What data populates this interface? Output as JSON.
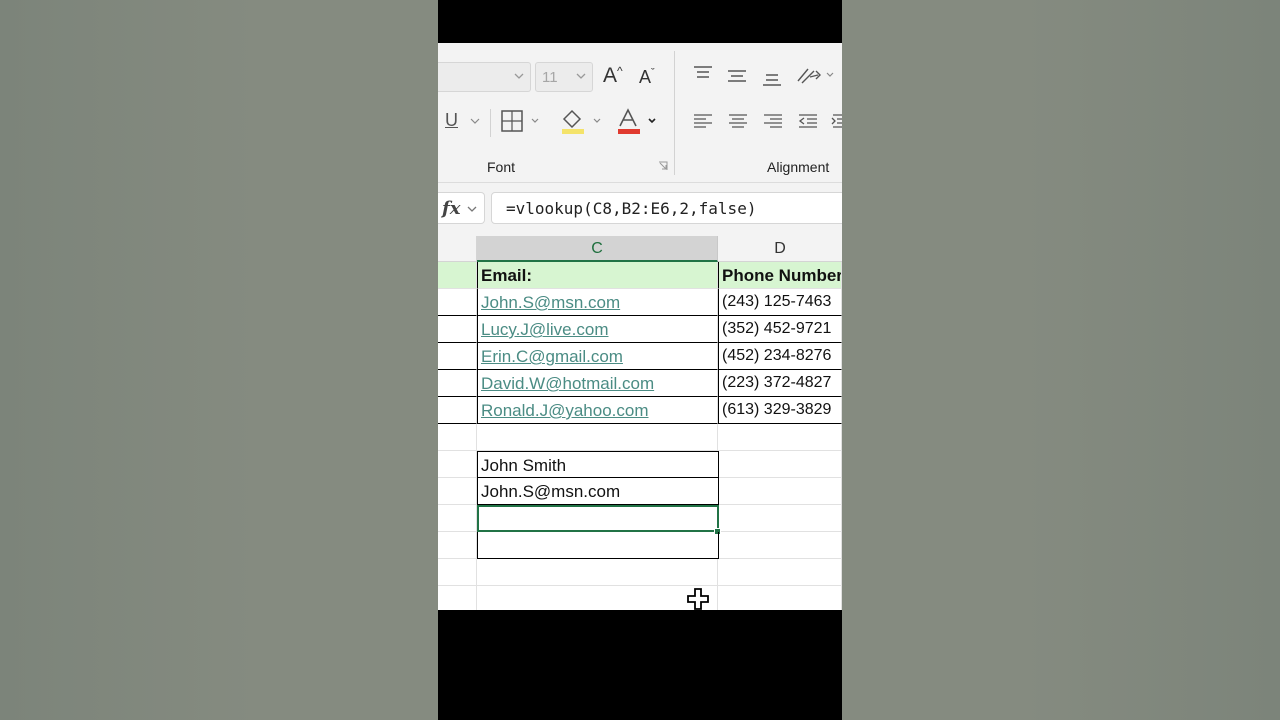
{
  "ribbon": {
    "font_size_value": "11",
    "font_group_label": "Font",
    "alignment_group_label": "Alignment",
    "underline_glyph": "U"
  },
  "formula_bar": {
    "fx_label": "fx",
    "formula": "=vlookup(C8,B2:E6,2,false)"
  },
  "columns": [
    "C",
    "D"
  ],
  "rows": [
    {
      "c": "Email:",
      "d": "Phone Number",
      "style": "header"
    },
    {
      "c": "John.S@msn.com",
      "d": "(243) 125-7463",
      "style": "link"
    },
    {
      "c": "Lucy.J@live.com",
      "d": "(352) 452-9721",
      "style": "link"
    },
    {
      "c": "Erin.C@gmail.com",
      "d": "(452) 234-8276",
      "style": "link"
    },
    {
      "c": "David.W@hotmail.com",
      "d": " (223) 372-4827",
      "style": "link"
    },
    {
      "c": "Ronald.J@yahoo.com ",
      "d": "(613) 329-3829",
      "style": "link"
    },
    {
      "c": "",
      "d": "",
      "style": "plain"
    },
    {
      "c": "John Smith",
      "d": "",
      "style": "boxed"
    },
    {
      "c": "John.S@msn.com",
      "d": "",
      "style": "boxed"
    },
    {
      "c": "",
      "d": "",
      "style": "selected"
    },
    {
      "c": "",
      "d": "",
      "style": "boxed"
    },
    {
      "c": "",
      "d": "",
      "style": "plain"
    },
    {
      "c": "",
      "d": "",
      "style": "plain"
    }
  ],
  "icons": {
    "grow_font": "increase-font-size-icon",
    "shrink_font": "decrease-font-size-icon",
    "borders": "borders-icon",
    "fill_color": "fill-color-icon",
    "font_color": "font-color-icon",
    "cursor": "cell-select-cursor-icon"
  },
  "colors": {
    "accent": "#217346",
    "header_fill": "#d7f5d1",
    "link": "#4b8c84",
    "font_color_bar": "#e03a2f",
    "fill_color_bar": "#f4e36a"
  }
}
